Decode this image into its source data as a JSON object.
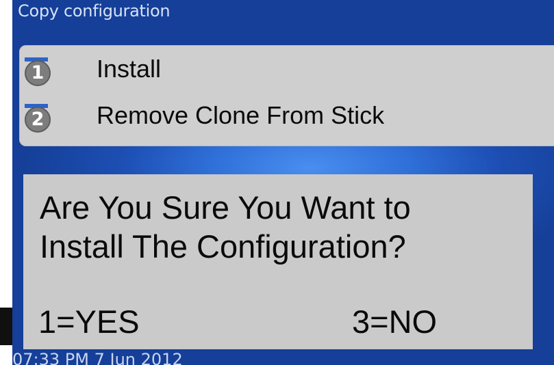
{
  "screen": {
    "title": "Copy configuration",
    "footer_datetime": "07:33 PM 7 Jun 2012"
  },
  "menu": {
    "items": [
      {
        "number": "1",
        "label": "Install"
      },
      {
        "number": "2",
        "label": "Remove Clone From Stick"
      }
    ]
  },
  "dialog": {
    "question_line1": "Are You Sure You Want to",
    "question_line2": "Install The Configuration?",
    "yes_option": "1=YES",
    "no_option": "3=NO"
  },
  "colors": {
    "background_blue": "#2f6fd8",
    "panel_gray": "#cfcfcf",
    "badge_gray": "#7d7d7d"
  }
}
